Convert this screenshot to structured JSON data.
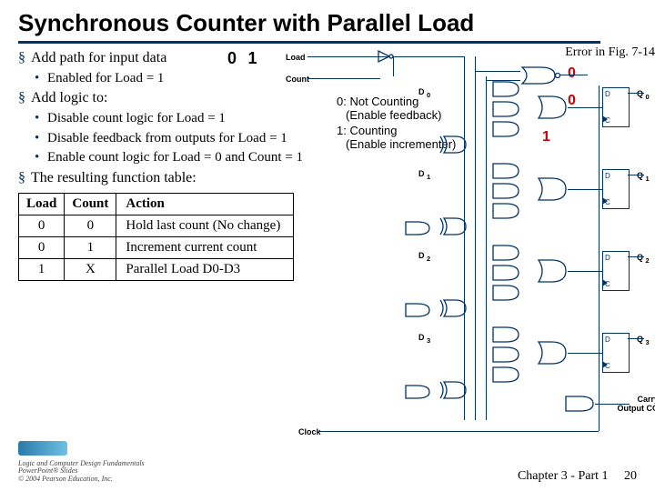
{
  "title": "Synchronous Counter with Parallel Load",
  "header_bits": {
    "b0": "0",
    "b1": "1"
  },
  "bullets": {
    "l1a": "Add path for input data",
    "l2a": "Enabled for Load = 1",
    "l1b": "Add logic to:",
    "l2b": "Disable count logic for Load = 1",
    "l2c": "Disable feedback from outputs for Load = 1",
    "l2d": "Enable count logic for Load = 0 and Count = 1",
    "l1c": "The resulting function table:"
  },
  "table": {
    "h1": "Load",
    "h2": "Count",
    "h3": "Action",
    "r1c1": "0",
    "r1c2": "0",
    "r1c3": "Hold last count (No change)",
    "r2c1": "0",
    "r2c2": "1",
    "r2c3": "Increment current count",
    "r3c1": "1",
    "r3c2": "X",
    "r3c3": "Parallel Load D0-D3"
  },
  "diagram": {
    "error": "Error in Fig. 7-14",
    "load": "Load",
    "count": "Count",
    "clock": "Clock",
    "d0": "D",
    "d0s": "0",
    "d1": "D",
    "d1s": "1",
    "d2": "D",
    "d2s": "2",
    "d3": "D",
    "d3s": "3",
    "q0": "Q",
    "q0s": "0",
    "q1": "Q",
    "q1s": "1",
    "q2": "Q",
    "q2s": "2",
    "q3": "Q",
    "q3s": "3",
    "carry1": "Carry",
    "carry2": "Output CO",
    "anno1a": "0: Not Counting",
    "anno1b": "(Enable feedback)",
    "anno2a": "1: Counting",
    "anno2b": "(Enable incrementer)",
    "red0a": "0",
    "red0b": "0",
    "red1": "1"
  },
  "footer": {
    "line1": "Logic and Computer Design Fundamentals",
    "line2": "PowerPoint® Slides",
    "line3": "© 2004 Pearson Education, Inc.",
    "chapter": "Chapter 3 - Part 1",
    "page": "20"
  }
}
